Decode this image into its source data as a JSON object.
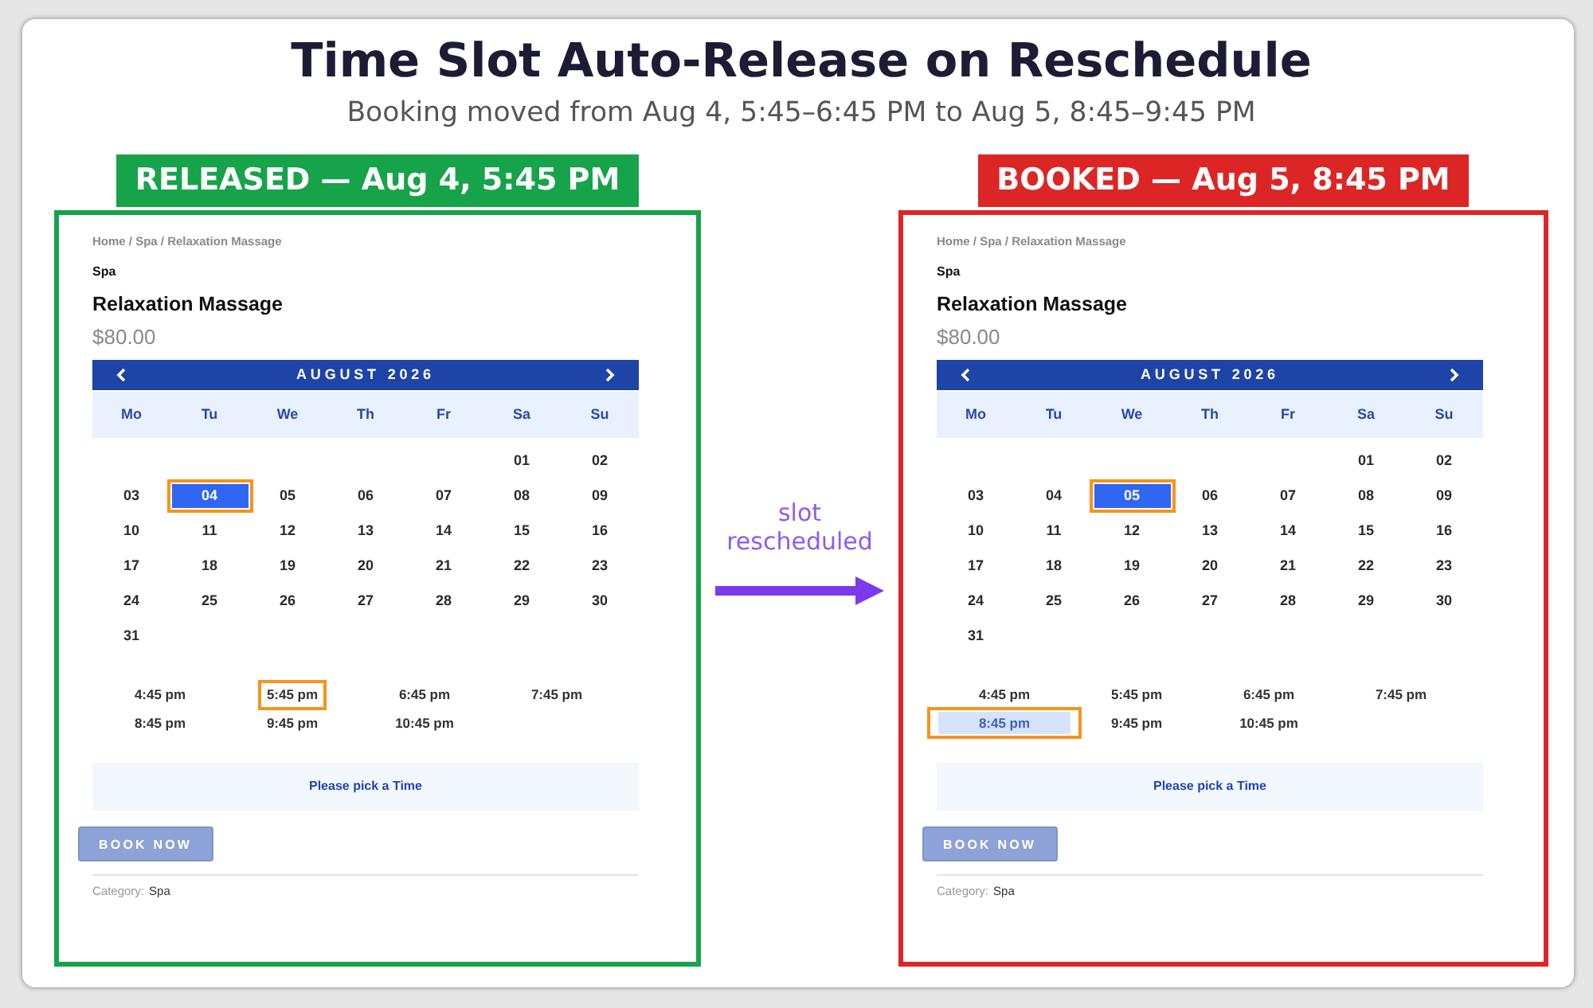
{
  "title": "Time Slot Auto-Release on Reschedule",
  "subtitle": "Booking moved from Aug 4, 5:45–6:45 PM to Aug 5, 8:45–9:45 PM",
  "panels": [
    {
      "label": "RELEASED — Aug 4, 5:45 PM",
      "color": "#16a34a",
      "page": {
        "breadcrumb": "Home / Spa / Relaxation Massage",
        "category_heading": "Spa",
        "product_title": "Relaxation Massage",
        "price": "$80.00",
        "calendar": {
          "month": "AUGUST 2026",
          "weekdays": [
            "Mo",
            "Tu",
            "We",
            "Th",
            "Fr",
            "Sa",
            "Su"
          ],
          "weeks": [
            [
              {
                "label": "01",
                "selected": false,
                "highlighted": false
              },
              {
                "label": "02",
                "selected": false,
                "highlighted": false
              }
            ],
            [
              {
                "label": "03",
                "selected": false,
                "highlighted": false
              },
              {
                "label": "04",
                "selected": true,
                "highlighted": true
              },
              {
                "label": "05",
                "selected": false,
                "highlighted": false
              },
              {
                "label": "06",
                "selected": false,
                "highlighted": false
              },
              {
                "label": "07",
                "selected": false,
                "highlighted": false
              },
              {
                "label": "08",
                "selected": false,
                "highlighted": false
              },
              {
                "label": "09",
                "selected": false,
                "highlighted": false
              }
            ],
            [
              {
                "label": "10",
                "selected": false,
                "highlighted": false
              },
              {
                "label": "11",
                "selected": false,
                "highlighted": false
              },
              {
                "label": "12",
                "selected": false,
                "highlighted": false
              },
              {
                "label": "13",
                "selected": false,
                "highlighted": false
              },
              {
                "label": "14",
                "selected": false,
                "highlighted": false
              },
              {
                "label": "15",
                "selected": false,
                "highlighted": false
              },
              {
                "label": "16",
                "selected": false,
                "highlighted": false
              }
            ],
            [
              {
                "label": "17",
                "selected": false,
                "highlighted": false
              },
              {
                "label": "18",
                "selected": false,
                "highlighted": false
              },
              {
                "label": "19",
                "selected": false,
                "highlighted": false
              },
              {
                "label": "20",
                "selected": false,
                "highlighted": false
              },
              {
                "label": "21",
                "selected": false,
                "highlighted": false
              },
              {
                "label": "22",
                "selected": false,
                "highlighted": false
              },
              {
                "label": "23",
                "selected": false,
                "highlighted": false
              }
            ],
            [
              {
                "label": "24",
                "selected": false,
                "highlighted": false
              },
              {
                "label": "25",
                "selected": false,
                "highlighted": false
              },
              {
                "label": "26",
                "selected": false,
                "highlighted": false
              },
              {
                "label": "27",
                "selected": false,
                "highlighted": false
              },
              {
                "label": "28",
                "selected": false,
                "highlighted": false
              },
              {
                "label": "29",
                "selected": false,
                "highlighted": false
              },
              {
                "label": "30",
                "selected": false,
                "highlighted": false
              }
            ],
            [
              {
                "label": "31",
                "selected": false,
                "highlighted": false
              }
            ]
          ]
        },
        "time_slots": [
          {
            "label": "4:45 pm",
            "booked": false,
            "highlighted": false
          },
          {
            "label": "5:45 pm",
            "booked": false,
            "highlighted": true
          },
          {
            "label": "6:45 pm",
            "booked": false,
            "highlighted": false
          },
          {
            "label": "7:45 pm",
            "booked": false,
            "highlighted": false
          },
          {
            "label": "8:45 pm",
            "booked": false,
            "highlighted": false
          },
          {
            "label": "9:45 pm",
            "booked": false,
            "highlighted": false
          },
          {
            "label": "10:45 pm",
            "booked": false,
            "highlighted": false
          }
        ],
        "prompt": "Please pick a Time",
        "button": "BOOK NOW",
        "category_label": "Category:",
        "category_value": "Spa"
      }
    },
    {
      "label": "BOOKED — Aug 5, 8:45 PM",
      "color": "#dc2626",
      "page": {
        "breadcrumb": "Home / Spa / Relaxation Massage",
        "category_heading": "Spa",
        "product_title": "Relaxation Massage",
        "price": "$80.00",
        "calendar": {
          "month": "AUGUST 2026",
          "weekdays": [
            "Mo",
            "Tu",
            "We",
            "Th",
            "Fr",
            "Sa",
            "Su"
          ],
          "weeks": [
            [
              {
                "label": "01",
                "selected": false,
                "highlighted": false
              },
              {
                "label": "02",
                "selected": false,
                "highlighted": false
              }
            ],
            [
              {
                "label": "03",
                "selected": false,
                "highlighted": false
              },
              {
                "label": "04",
                "selected": false,
                "highlighted": false
              },
              {
                "label": "05",
                "selected": true,
                "highlighted": true
              },
              {
                "label": "06",
                "selected": false,
                "highlighted": false
              },
              {
                "label": "07",
                "selected": false,
                "highlighted": false
              },
              {
                "label": "08",
                "selected": false,
                "highlighted": false
              },
              {
                "label": "09",
                "selected": false,
                "highlighted": false
              }
            ],
            [
              {
                "label": "10",
                "selected": false,
                "highlighted": false
              },
              {
                "label": "11",
                "selected": false,
                "highlighted": false
              },
              {
                "label": "12",
                "selected": false,
                "highlighted": false
              },
              {
                "label": "13",
                "selected": false,
                "highlighted": false
              },
              {
                "label": "14",
                "selected": false,
                "highlighted": false
              },
              {
                "label": "15",
                "selected": false,
                "highlighted": false
              },
              {
                "label": "16",
                "selected": false,
                "highlighted": false
              }
            ],
            [
              {
                "label": "17",
                "selected": false,
                "highlighted": false
              },
              {
                "label": "18",
                "selected": false,
                "highlighted": false
              },
              {
                "label": "19",
                "selected": false,
                "highlighted": false
              },
              {
                "label": "20",
                "selected": false,
                "highlighted": false
              },
              {
                "label": "21",
                "selected": false,
                "highlighted": false
              },
              {
                "label": "22",
                "selected": false,
                "highlighted": false
              },
              {
                "label": "23",
                "selected": false,
                "highlighted": false
              }
            ],
            [
              {
                "label": "24",
                "selected": false,
                "highlighted": false
              },
              {
                "label": "25",
                "selected": false,
                "highlighted": false
              },
              {
                "label": "26",
                "selected": false,
                "highlighted": false
              },
              {
                "label": "27",
                "selected": false,
                "highlighted": false
              },
              {
                "label": "28",
                "selected": false,
                "highlighted": false
              },
              {
                "label": "29",
                "selected": false,
                "highlighted": false
              },
              {
                "label": "30",
                "selected": false,
                "highlighted": false
              }
            ],
            [
              {
                "label": "31",
                "selected": false,
                "highlighted": false
              }
            ]
          ]
        },
        "time_slots": [
          {
            "label": "4:45 pm",
            "booked": false,
            "highlighted": false
          },
          {
            "label": "5:45 pm",
            "booked": false,
            "highlighted": false
          },
          {
            "label": "6:45 pm",
            "booked": false,
            "highlighted": false
          },
          {
            "label": "7:45 pm",
            "booked": false,
            "highlighted": false
          },
          {
            "label": "8:45 pm",
            "booked": true,
            "highlighted": true
          },
          {
            "label": "9:45 pm",
            "booked": false,
            "highlighted": false
          },
          {
            "label": "10:45 pm",
            "booked": false,
            "highlighted": false
          }
        ],
        "prompt": "Please pick a Time",
        "button": "BOOK NOW",
        "category_label": "Category:",
        "category_value": "Spa"
      }
    }
  ],
  "transition": {
    "label": "slot rescheduled"
  }
}
